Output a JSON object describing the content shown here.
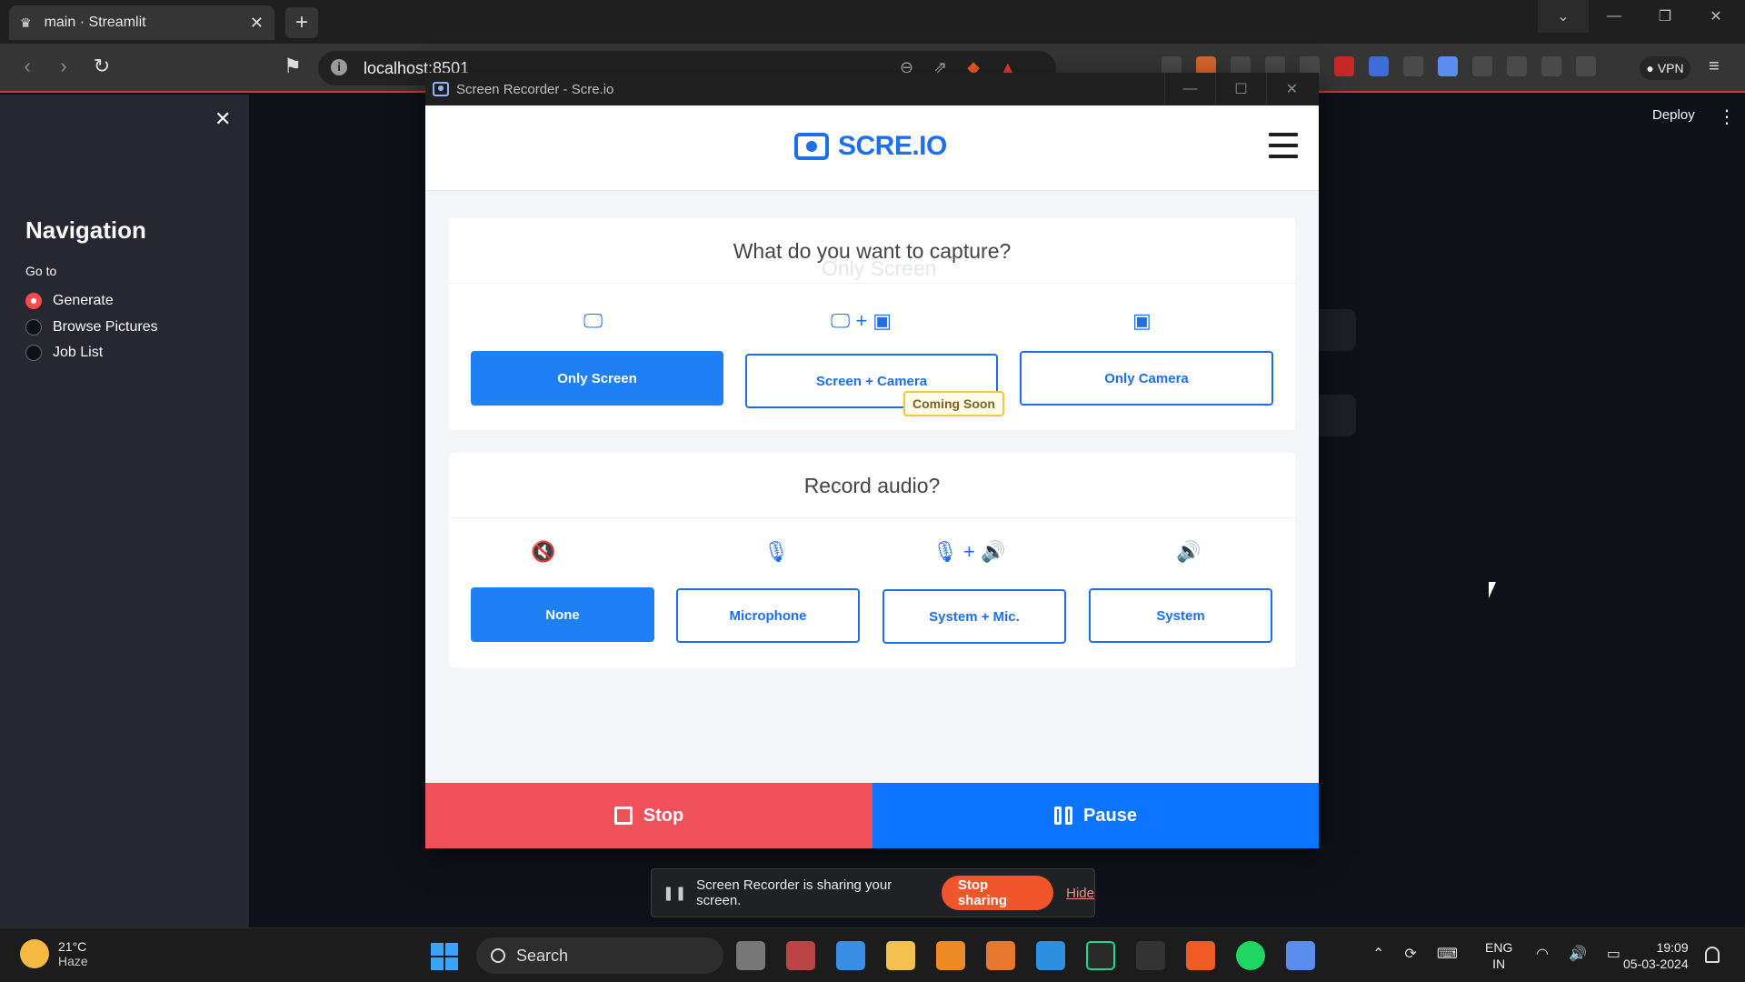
{
  "browser": {
    "tab_title": "main · Streamlit",
    "url": "localhost:8501",
    "vpn_label": "VPN",
    "tab_close": "✕",
    "newtab": "+"
  },
  "streamlit": {
    "sidebar_title": "Navigation",
    "goto_label": "Go to",
    "nav_options": [
      {
        "label": "Generate",
        "selected": true
      },
      {
        "label": "Browse Pictures",
        "selected": false
      },
      {
        "label": "Job List",
        "selected": false
      }
    ],
    "deploy_label": "Deploy",
    "close": "✕"
  },
  "recorder": {
    "window_title": "Screen Recorder - Scre.io",
    "logo_text": "SCRE.IO",
    "capture_question": "What do you want to capture?",
    "ghost_text": "Only Screen",
    "capture_options": [
      {
        "label": "Only Screen",
        "icon": "monitor-icon",
        "selected": true
      },
      {
        "label": "Screen + Camera",
        "icon": "monitor-plus-camera-icon",
        "selected": false
      },
      {
        "label": "Only Camera",
        "icon": "camera-icon",
        "selected": false
      }
    ],
    "coming_soon": "Coming Soon",
    "audio_question": "Record audio?",
    "audio_options": [
      {
        "label": "None",
        "icon": "mute-icon",
        "selected": true
      },
      {
        "label": "Microphone",
        "icon": "microphone-icon",
        "selected": false
      },
      {
        "label": "System + Mic.",
        "icon": "mic-plus-speaker-icon",
        "selected": false
      },
      {
        "label": "System",
        "icon": "speaker-icon",
        "selected": false
      }
    ],
    "stop_label": "Stop",
    "pause_label": "Pause",
    "colors": {
      "accent": "#1f6feb",
      "stop": "#f0505a",
      "pause": "#0d74ff"
    }
  },
  "share_bar": {
    "message": "Screen Recorder is sharing your screen.",
    "stop_label": "Stop sharing",
    "hide_label": "Hide"
  },
  "taskbar": {
    "temperature": "21°C",
    "weather": "Haze",
    "search_label": "Search",
    "lang_1": "ENG",
    "lang_2": "IN",
    "time": "19:09",
    "date": "05-03-2024"
  }
}
